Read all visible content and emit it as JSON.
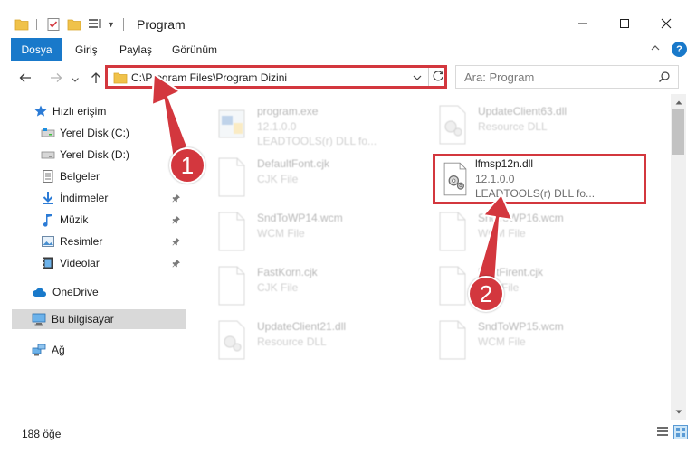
{
  "window": {
    "title": "Program"
  },
  "ribbon": {
    "tabs": [
      "Dosya",
      "Giriş",
      "Paylaş",
      "Görünüm"
    ],
    "help_label": "?"
  },
  "address": {
    "path": "C:\\Program Files\\Program Dizini"
  },
  "search": {
    "placeholder": "Ara: Program"
  },
  "nav_pane": {
    "items": [
      {
        "label": "Hızlı erişim",
        "icon": "star-icon",
        "pinned": false
      },
      {
        "label": "Yerel Disk (C:)",
        "icon": "drive-c-icon",
        "pinned": false
      },
      {
        "label": "Yerel Disk (D:)",
        "icon": "drive-d-icon",
        "pinned": false
      },
      {
        "label": "Belgeler",
        "icon": "documents-icon",
        "pinned": false
      },
      {
        "label": "İndirmeler",
        "icon": "downloads-icon",
        "pinned": true
      },
      {
        "label": "Müzik",
        "icon": "music-icon",
        "pinned": true
      },
      {
        "label": "Resimler",
        "icon": "pictures-icon",
        "pinned": true
      },
      {
        "label": "Videolar",
        "icon": "videos-icon",
        "pinned": true
      },
      {
        "label": "OneDrive",
        "icon": "cloud-icon",
        "pinned": false
      },
      {
        "label": "Bu bilgisayar",
        "icon": "computer-icon",
        "pinned": false,
        "selected": true
      },
      {
        "label": "Ağ",
        "icon": "network-icon",
        "pinned": false
      }
    ]
  },
  "files": [
    {
      "name": "program.exe",
      "line2": "12.1.0.0",
      "line3": "LEADTOOLS(r) DLL fo...",
      "icon": "exe-icon",
      "highlight": false
    },
    {
      "name": "UpdateClient63.dll",
      "line2": "Resource DLL",
      "line3": "",
      "icon": "dll-gear-icon",
      "highlight": false
    },
    {
      "name": "DefaultFont.cjk",
      "line2": "CJK File",
      "line3": "",
      "icon": "blank-file-icon",
      "highlight": false
    },
    {
      "name": "lfmsp12n.dll",
      "line2": "12.1.0.0",
      "line3": "LEADTOOLS(r) DLL fo...",
      "icon": "dll-gear-icon",
      "highlight": true
    },
    {
      "name": "SndToWP14.wcm",
      "line2": "WCM File",
      "line3": "",
      "icon": "blank-file-icon",
      "highlight": false
    },
    {
      "name": "SndToWP16.wcm",
      "line2": "WCM File",
      "line3": "",
      "icon": "blank-file-icon",
      "highlight": false
    },
    {
      "name": "FastKorn.cjk",
      "line2": "CJK File",
      "line3": "",
      "icon": "blank-file-icon",
      "highlight": false
    },
    {
      "name": "FastFirent.cjk",
      "line2": "CJK File",
      "line3": "",
      "icon": "blank-file-icon",
      "highlight": false
    },
    {
      "name": "UpdateClient21.dll",
      "line2": "Resource DLL",
      "line3": "",
      "icon": "dll-gear-icon",
      "highlight": false
    },
    {
      "name": "SndToWP15.wcm",
      "line2": "WCM File",
      "line3": "",
      "icon": "blank-file-icon",
      "highlight": false
    }
  ],
  "status": {
    "item_count": "188 öğe"
  },
  "annotations": {
    "step1": "1",
    "step2": "2",
    "color": "#d3373e"
  },
  "colors": {
    "accent": "#1979ca",
    "highlight_border": "#d3373e",
    "selected_bg": "#d9d9d9"
  }
}
